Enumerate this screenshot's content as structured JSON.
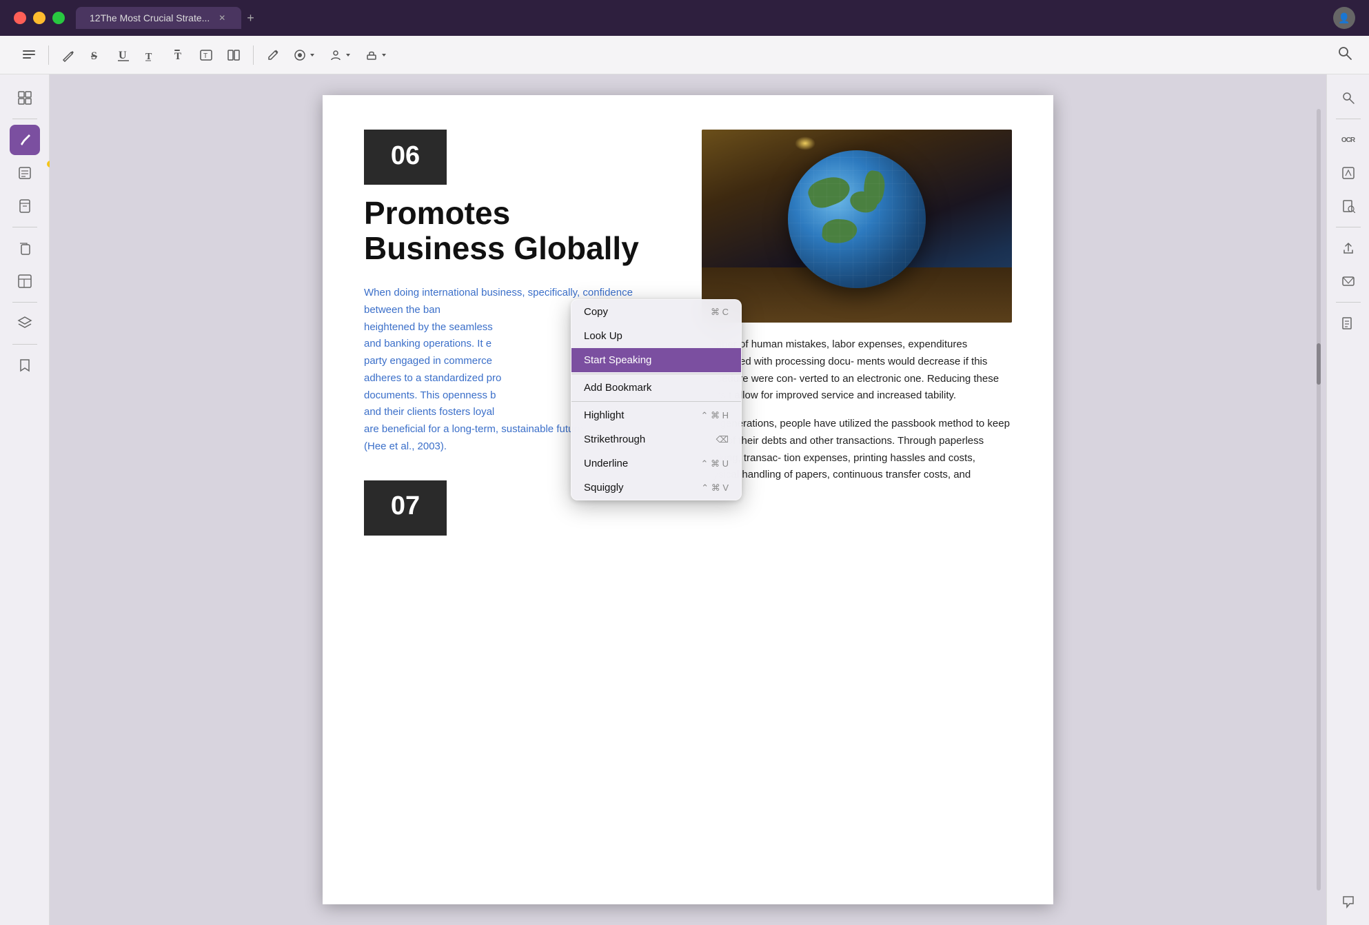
{
  "titlebar": {
    "tab_title": "12The Most Crucial Strate...",
    "add_tab_label": "+"
  },
  "toolbar": {
    "icons": [
      {
        "name": "annotations-icon",
        "symbol": "☰"
      },
      {
        "name": "highlight-pen-icon",
        "symbol": "✏"
      },
      {
        "name": "strikethrough-icon",
        "symbol": "S"
      },
      {
        "name": "underline-icon",
        "symbol": "U"
      },
      {
        "name": "text-size-icon",
        "symbol": "T"
      },
      {
        "name": "bold-text-icon",
        "symbol": "T"
      },
      {
        "name": "text-box-icon",
        "symbol": "⊡"
      },
      {
        "name": "columns-icon",
        "symbol": "≡"
      },
      {
        "name": "pencil-icon",
        "symbol": "✏"
      },
      {
        "name": "color-fill-icon",
        "symbol": "◎"
      },
      {
        "name": "person-icon",
        "symbol": "👤"
      },
      {
        "name": "stamp-icon",
        "symbol": "🖋"
      }
    ],
    "search_icon": "🔍"
  },
  "sidebar": {
    "items": [
      {
        "name": "thumbnail-icon",
        "symbol": "⊞",
        "active": false
      },
      {
        "name": "highlight-icon",
        "symbol": "🖊",
        "active": true
      },
      {
        "name": "notes-icon",
        "symbol": "📝",
        "active": false
      },
      {
        "name": "bookmarks-icon",
        "symbol": "📋",
        "active": false
      },
      {
        "name": "copy-icon",
        "symbol": "⧉",
        "active": false
      },
      {
        "name": "template-icon",
        "symbol": "⊟",
        "active": false
      },
      {
        "name": "layers-icon",
        "symbol": "◫",
        "active": false
      },
      {
        "name": "bookmark-icon",
        "symbol": "🔖",
        "active": false
      }
    ]
  },
  "right_sidebar": {
    "items": [
      {
        "name": "search-icon",
        "symbol": "🔍"
      },
      {
        "name": "ocr-icon",
        "symbol": "OCR"
      },
      {
        "name": "edit-icon",
        "symbol": "✏"
      },
      {
        "name": "pdf-search-icon",
        "symbol": "🔍"
      },
      {
        "name": "share-icon",
        "symbol": "⬆"
      },
      {
        "name": "email-icon",
        "symbol": "✉"
      },
      {
        "name": "convert-icon",
        "symbol": "⎙"
      },
      {
        "name": "comment-icon",
        "symbol": "💬"
      }
    ]
  },
  "page": {
    "chapter_number": "06",
    "chapter_title_line1": "Promotes",
    "chapter_title_line2": "Business Globally",
    "selected_paragraph": "When doing international business, specifically, confidence between the ban heightened by the seamless and banking operations. It e party engaged in commerce adheres to a standardized pro documents. This openness b and their clients fosters loyal are beneficial for a long-term, sustainable future (Hee et al., 2003).",
    "right_body_text": "number of human mistakes, labor expenses, expenditures associated with processing docu- ments would decrease if this procedure were con- verted to an electronic one. Reducing these costs t allow for improved service and increased tability.",
    "right_body_text2": "For generations, people have utilized the passbook method to keep track of their debts and other transactions. Through paperless banking, transac- tion expenses, printing hassles and costs, physical handling of papers, continuous transfer costs, and",
    "chapter_07": "07"
  },
  "context_menu": {
    "items": [
      {
        "label": "Copy",
        "shortcut": "⌘ C",
        "active": false
      },
      {
        "label": "Look Up",
        "shortcut": "",
        "active": false
      },
      {
        "label": "Start Speaking",
        "shortcut": "",
        "active": true
      },
      {
        "label": "Add Bookmark",
        "shortcut": "",
        "active": false
      },
      {
        "label": "Highlight",
        "shortcut": "⌃ ⌘ H",
        "active": false
      },
      {
        "label": "Strikethrough",
        "shortcut": "⌫",
        "active": false
      },
      {
        "label": "Underline",
        "shortcut": "⌃ ⌘ U",
        "active": false
      },
      {
        "label": "Squiggly",
        "shortcut": "⌃ ⌘ V",
        "active": false
      }
    ]
  }
}
